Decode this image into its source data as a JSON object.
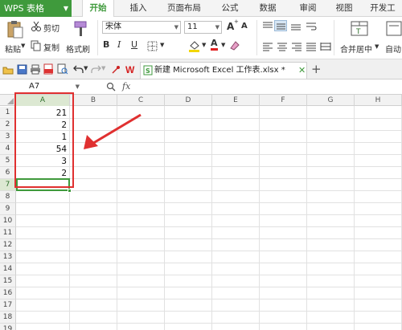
{
  "app": {
    "name": "WPS 表格"
  },
  "menu_tabs": [
    "开始",
    "插入",
    "页面布局",
    "公式",
    "数据",
    "审阅",
    "视图",
    "开发工"
  ],
  "ribbon": {
    "paste_label": "粘贴",
    "cut_label": "剪切",
    "copy_label": "复制",
    "format_painter_label": "格式刷",
    "font_name": "宋体",
    "font_size": "11",
    "merge_center_label": "合并居中",
    "auto_label": "自动",
    "grow_font": "A",
    "shrink_font": "A",
    "bold": "B",
    "italic": "I",
    "underline": "U",
    "font_color": "A"
  },
  "document": {
    "tab_title": "新建 Microsoft Excel 工作表.xlsx *"
  },
  "formula_bar": {
    "cell_ref": "A7",
    "fx_label": "fx",
    "formula": ""
  },
  "columns": [
    "A",
    "B",
    "C",
    "D",
    "E",
    "F",
    "G",
    "H"
  ],
  "rows": [
    "1",
    "2",
    "3",
    "4",
    "5",
    "6",
    "7",
    "8",
    "9",
    "10",
    "11",
    "12",
    "13",
    "14",
    "15",
    "16",
    "17",
    "18",
    "19"
  ],
  "cells_column_a": [
    "21",
    "2",
    "1",
    "54",
    "3",
    "2"
  ],
  "selection": {
    "active_cell": "A7",
    "active_column": "A",
    "active_row": "7"
  },
  "colors": {
    "accent_green": "#3f9a3c",
    "annotation_red": "#e03030"
  }
}
